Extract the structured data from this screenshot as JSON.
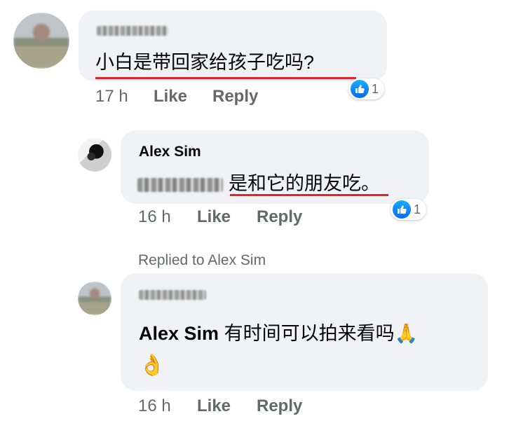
{
  "comments": [
    {
      "author": "Jinna Lim",
      "text": "小白是带回家给孩子吃吗?",
      "time": "17 h",
      "like_label": "Like",
      "reply_label": "Reply",
      "reaction_count": "1"
    },
    {
      "author": "Alex Sim",
      "mention": "Jinna Lim",
      "text": "是和它的朋友吃。",
      "time": "16 h",
      "like_label": "Like",
      "reply_label": "Reply",
      "reaction_count": "1"
    },
    {
      "replied_to": "Replied to Alex Sim",
      "author": "Jinna Lim",
      "mention": "Alex Sim",
      "text": "有时间可以拍来看吗",
      "emoji_1": "🙏",
      "emoji_2": "👌",
      "time": "16 h",
      "like_label": "Like",
      "reply_label": "Reply"
    }
  ],
  "colors": {
    "bubble": "#f0f2f5",
    "meta": "#65676b",
    "like_blue": "#0866ff",
    "underline_red": "#e0242b"
  },
  "icons": [
    "like-reaction-icon"
  ]
}
